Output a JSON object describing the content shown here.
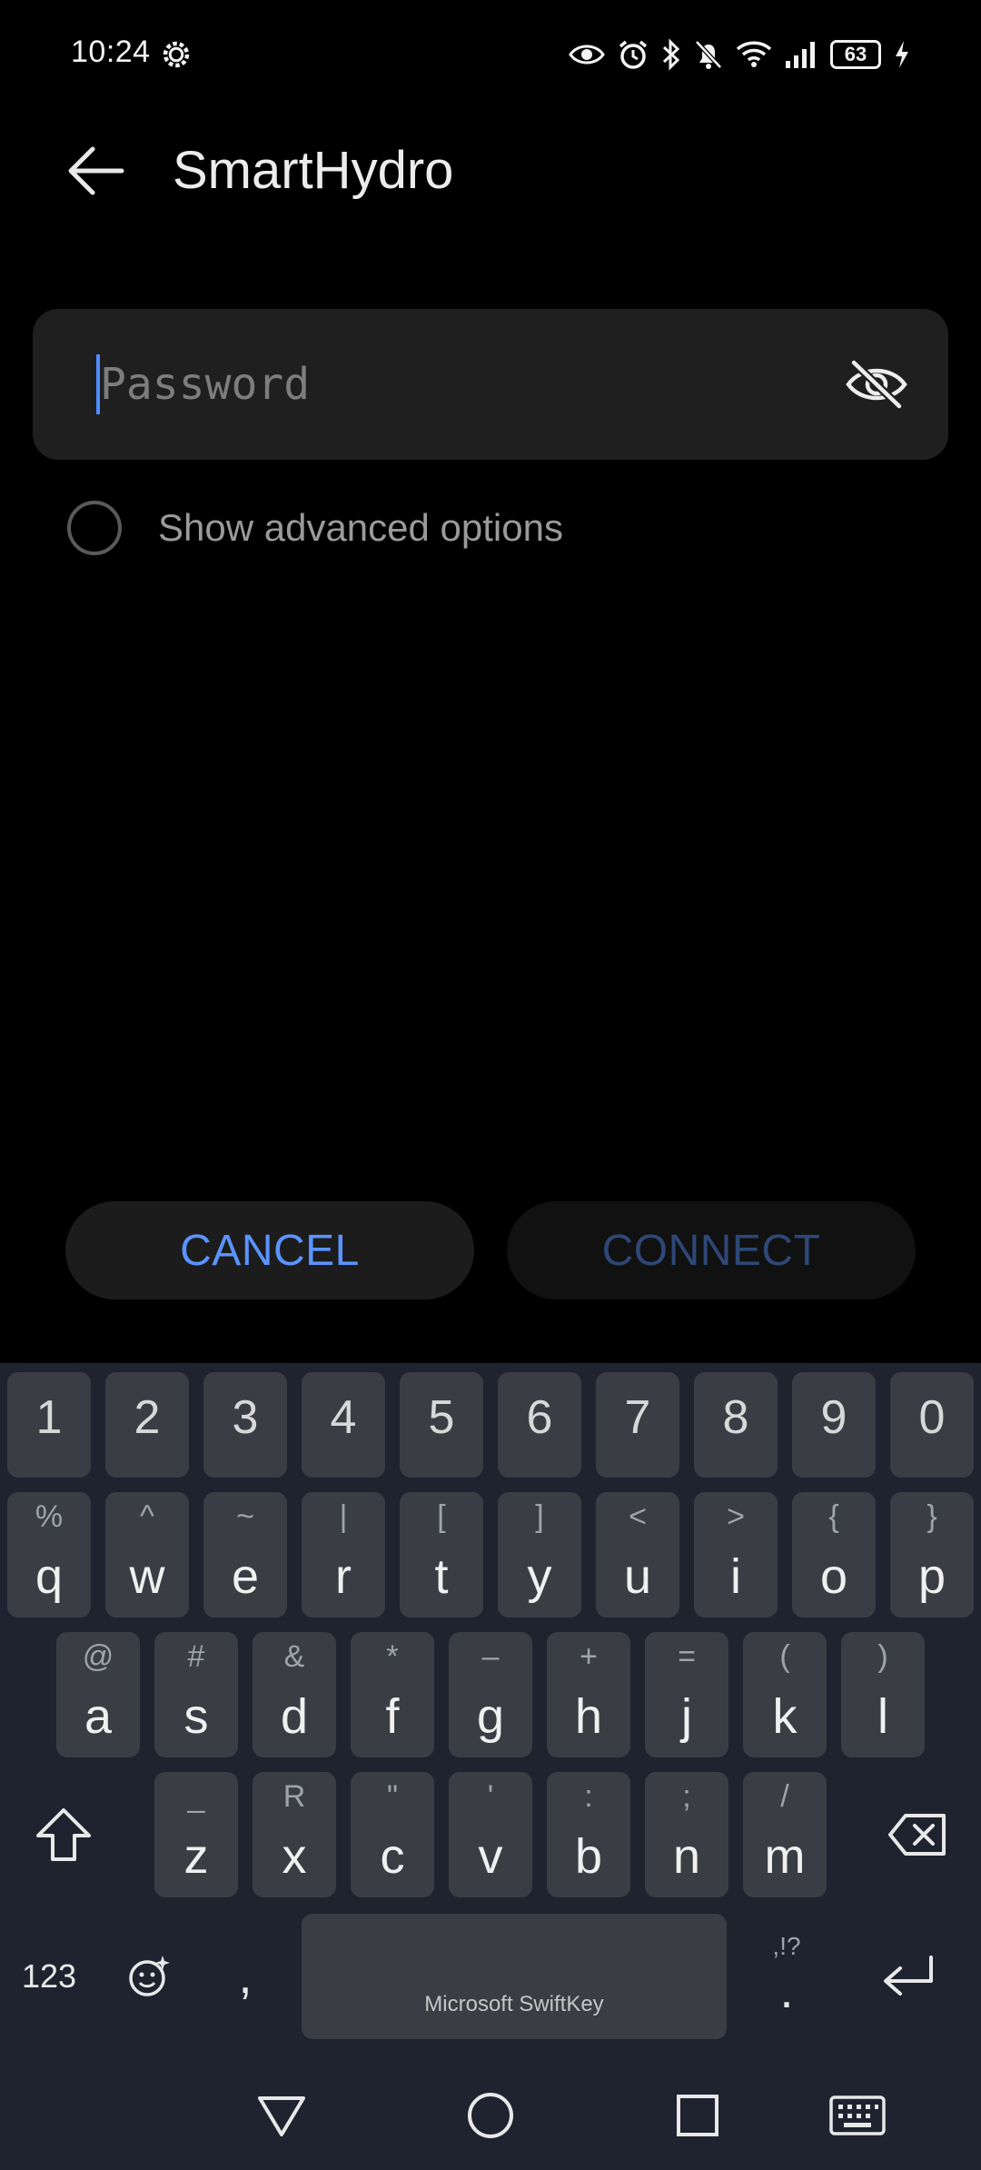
{
  "status_bar": {
    "time": "10:24",
    "battery": "63",
    "icons": [
      "gear-icon",
      "eye-icon",
      "alarm-icon",
      "bluetooth-icon",
      "bell-off-icon",
      "wifi-icon",
      "signal-icon",
      "battery-icon",
      "charging-icon"
    ]
  },
  "app_bar": {
    "title": "SmartHydro"
  },
  "password_field": {
    "placeholder": "Password",
    "value": ""
  },
  "advanced": {
    "label": "Show advanced options",
    "checked": false
  },
  "buttons": {
    "cancel": "CANCEL",
    "connect": "CONNECT"
  },
  "keyboard": {
    "number_row": [
      "1",
      "2",
      "3",
      "4",
      "5",
      "6",
      "7",
      "8",
      "9",
      "0"
    ],
    "row1": [
      {
        "key": "q",
        "alt": "%"
      },
      {
        "key": "w",
        "alt": "^"
      },
      {
        "key": "e",
        "alt": "~"
      },
      {
        "key": "r",
        "alt": "|"
      },
      {
        "key": "t",
        "alt": "["
      },
      {
        "key": "y",
        "alt": "]"
      },
      {
        "key": "u",
        "alt": "<"
      },
      {
        "key": "i",
        "alt": ">"
      },
      {
        "key": "o",
        "alt": "{"
      },
      {
        "key": "p",
        "alt": "}"
      }
    ],
    "row2": [
      {
        "key": "a",
        "alt": "@"
      },
      {
        "key": "s",
        "alt": "#"
      },
      {
        "key": "d",
        "alt": "&"
      },
      {
        "key": "f",
        "alt": "*"
      },
      {
        "key": "g",
        "alt": "–"
      },
      {
        "key": "h",
        "alt": "+"
      },
      {
        "key": "j",
        "alt": "="
      },
      {
        "key": "k",
        "alt": "("
      },
      {
        "key": "l",
        "alt": ")"
      }
    ],
    "row3": [
      {
        "key": "z",
        "alt": "_"
      },
      {
        "key": "x",
        "alt": "R"
      },
      {
        "key": "c",
        "alt": "\""
      },
      {
        "key": "v",
        "alt": "'"
      },
      {
        "key": "b",
        "alt": ":"
      },
      {
        "key": "n",
        "alt": ";"
      },
      {
        "key": "m",
        "alt": "/"
      }
    ],
    "numbers_switch": "123",
    "comma": ",",
    "period": ".",
    "period_alt": ",!?",
    "space_label": "Microsoft SwiftKey"
  }
}
